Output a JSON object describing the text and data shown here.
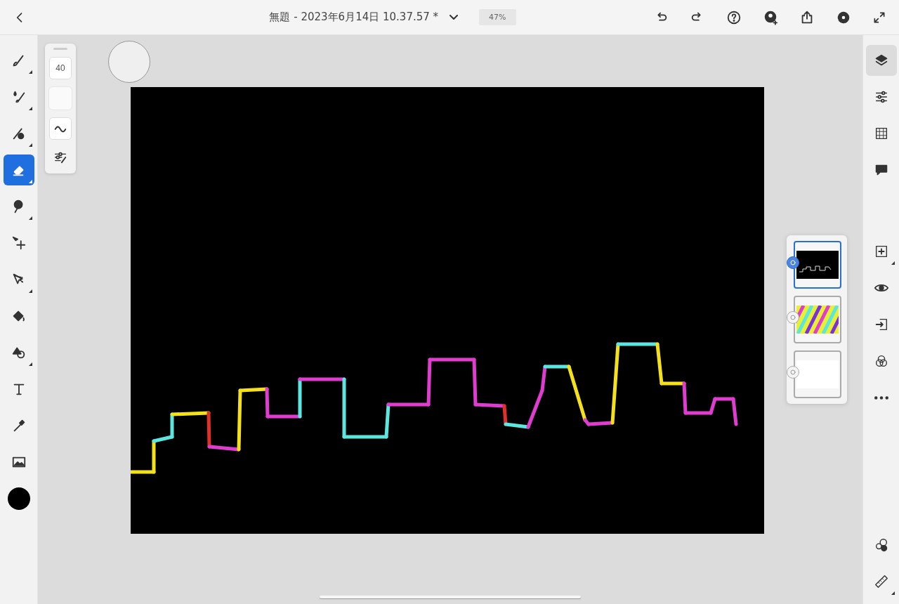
{
  "top_bar": {
    "title": "無題 - 2023年6月14日 10.37.57 *",
    "zoom": "47%"
  },
  "left_tools": [
    {
      "selected": false,
      "submenu": true
    },
    {
      "selected": false,
      "submenu": true
    },
    {
      "selected": false,
      "submenu": true
    },
    {
      "selected": true,
      "submenu": true
    },
    {
      "selected": false,
      "submenu": true
    },
    {
      "selected": false,
      "submenu": false
    },
    {
      "selected": false,
      "submenu": true
    },
    {
      "selected": false,
      "submenu": false
    },
    {
      "selected": false,
      "submenu": true
    },
    {
      "selected": false,
      "submenu": false
    },
    {
      "selected": false,
      "submenu": false
    },
    {
      "selected": false,
      "submenu": false
    }
  ],
  "brush_panel": {
    "size": "40"
  },
  "right_tools": [
    {
      "selected": true
    },
    {
      "selected": false
    },
    {
      "selected": false
    },
    {
      "selected": false
    }
  ],
  "layer_tools": [
    {
      "submenu": true
    },
    {
      "submenu": false
    },
    {
      "submenu": false
    },
    {
      "submenu": false
    },
    {
      "submenu": false
    }
  ],
  "bottom_tools": [
    {
      "submenu": false
    },
    {
      "submenu": true
    }
  ],
  "layers": [
    {
      "selected": true
    },
    {
      "selected": false
    },
    {
      "selected": false
    }
  ]
}
